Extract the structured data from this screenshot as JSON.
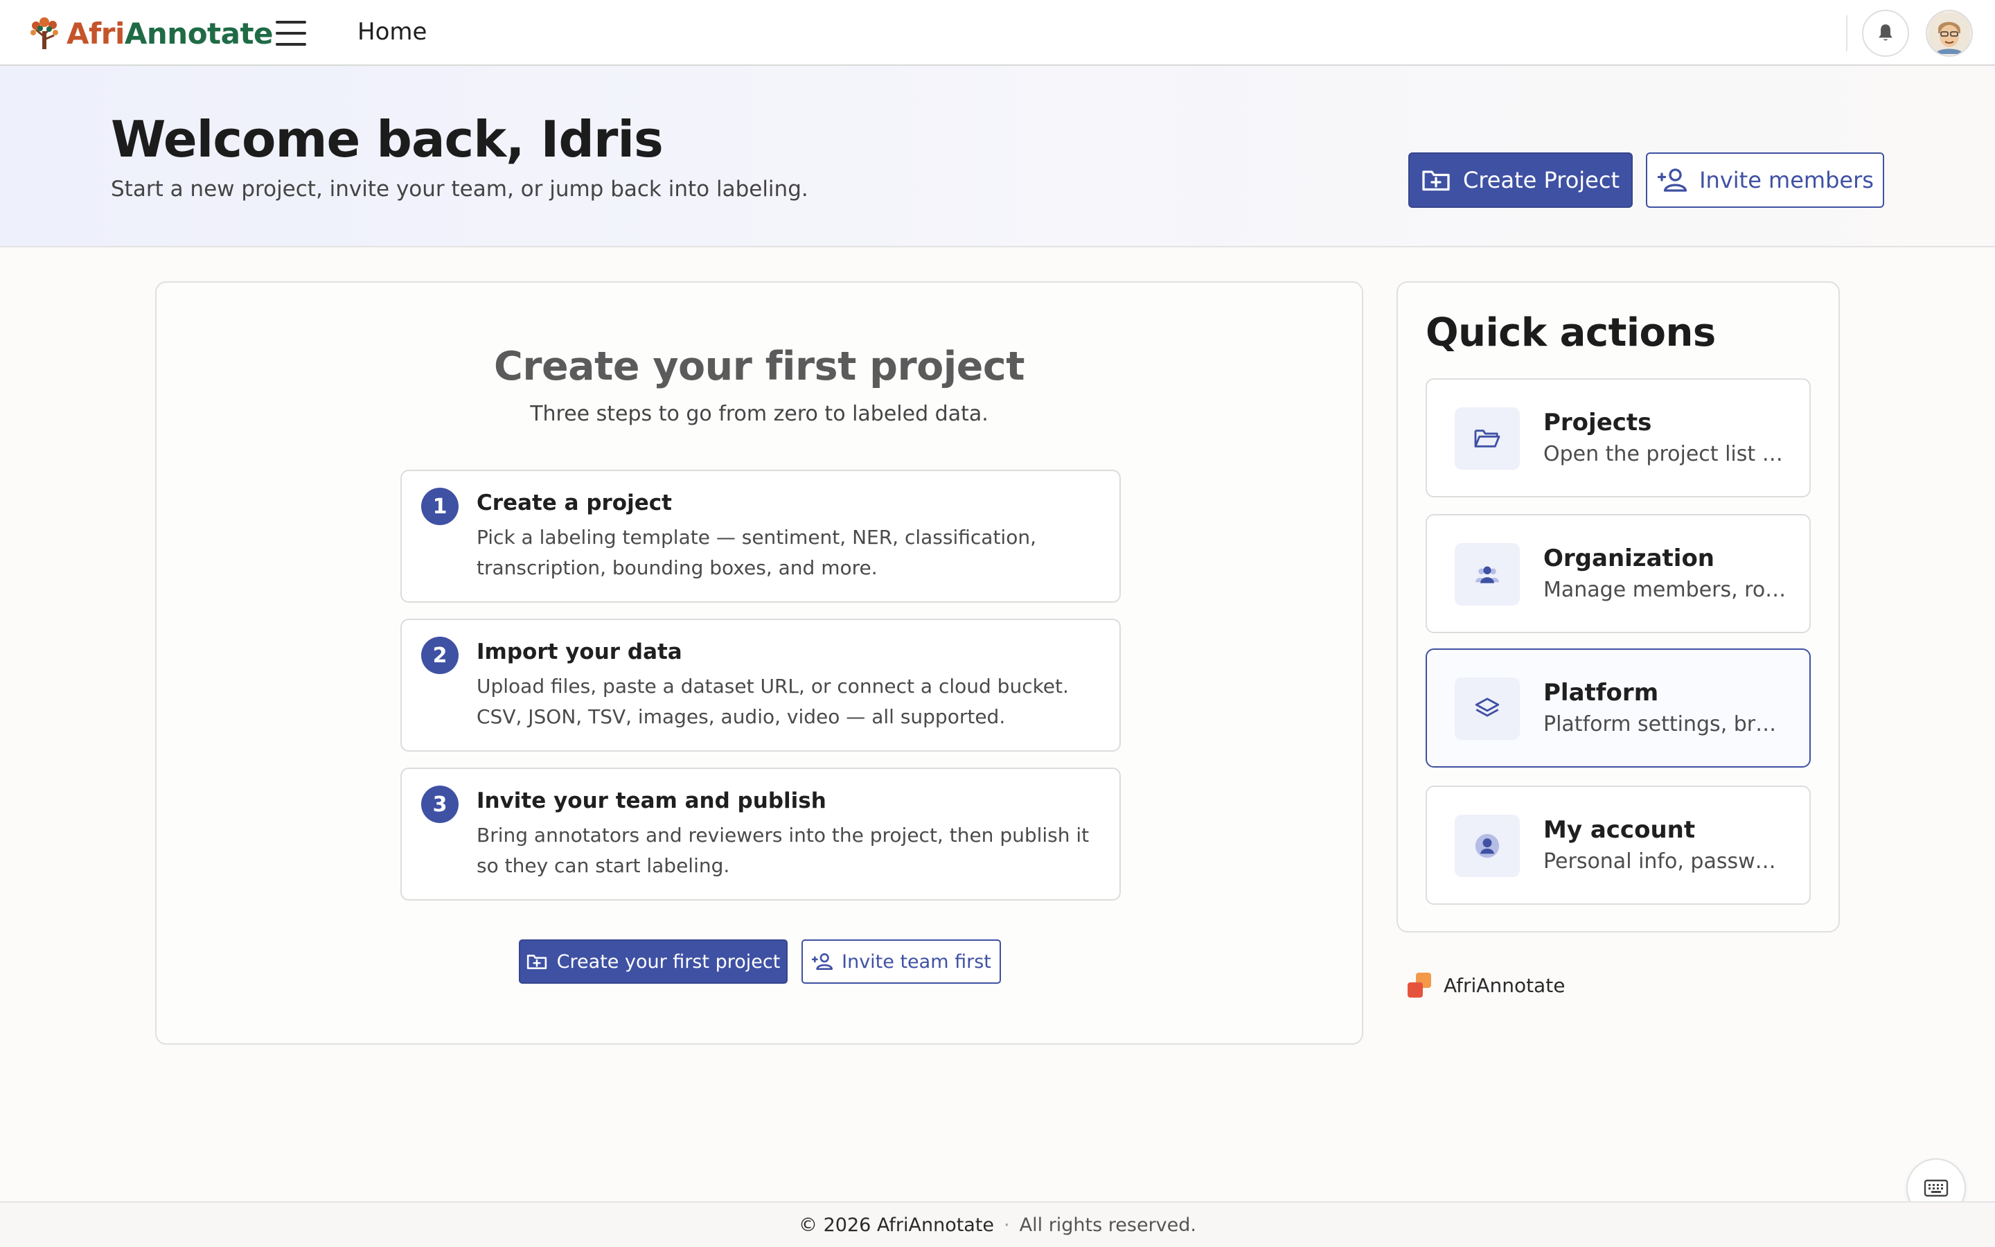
{
  "app": {
    "brand_part1": "Afri",
    "brand_part2": "Annotate",
    "page_title": "Home",
    "brand_colors": {
      "primary": "#3f51a3",
      "afri": "#c5542a",
      "annotate": "#1f6b46"
    }
  },
  "topbar": {
    "menu_icon": "hamburger-menu-icon",
    "notifications_icon": "bell-icon",
    "avatar_icon": "user-avatar"
  },
  "hero": {
    "title": "Welcome back, Idris",
    "subtitle": "Start a new project, invite your team, or jump back into labeling.",
    "create_project_label": "Create Project",
    "invite_members_label": "Invite members"
  },
  "onboarding": {
    "title": "Create your first project",
    "subtitle": "Three steps to go from zero to labeled data.",
    "steps": [
      {
        "number": "1",
        "title": "Create a project",
        "description": "Pick a labeling template — sentiment, NER, classification, transcription, bounding boxes, and more."
      },
      {
        "number": "2",
        "title": "Import your data",
        "description": "Upload files, paste a dataset URL, or connect a cloud bucket. CSV, JSON, TSV, images, audio, video — all supported."
      },
      {
        "number": "3",
        "title": "Invite your team and publish",
        "description": "Bring annotators and reviewers into the project, then publish it so they can start labeling."
      }
    ],
    "primary_label": "Create your first project",
    "secondary_label": "Invite team first"
  },
  "quick_actions": {
    "title": "Quick actions",
    "items": [
      {
        "title": "Projects",
        "description": "Open the project list and...",
        "icon": "folder-open-icon"
      },
      {
        "title": "Organization",
        "description": "Manage members, roles and...",
        "icon": "users-icon"
      },
      {
        "title": "Platform",
        "description": "Platform settings, branding...",
        "icon": "layers-icon"
      },
      {
        "title": "My account",
        "description": "Personal info, password...",
        "icon": "user-circle-icon"
      }
    ]
  },
  "sidebar_brand": {
    "label": "AfriAnnotate"
  },
  "footer": {
    "copyright": "© 2026 AfriAnnotate",
    "separator": "·",
    "rights": "All rights reserved."
  }
}
